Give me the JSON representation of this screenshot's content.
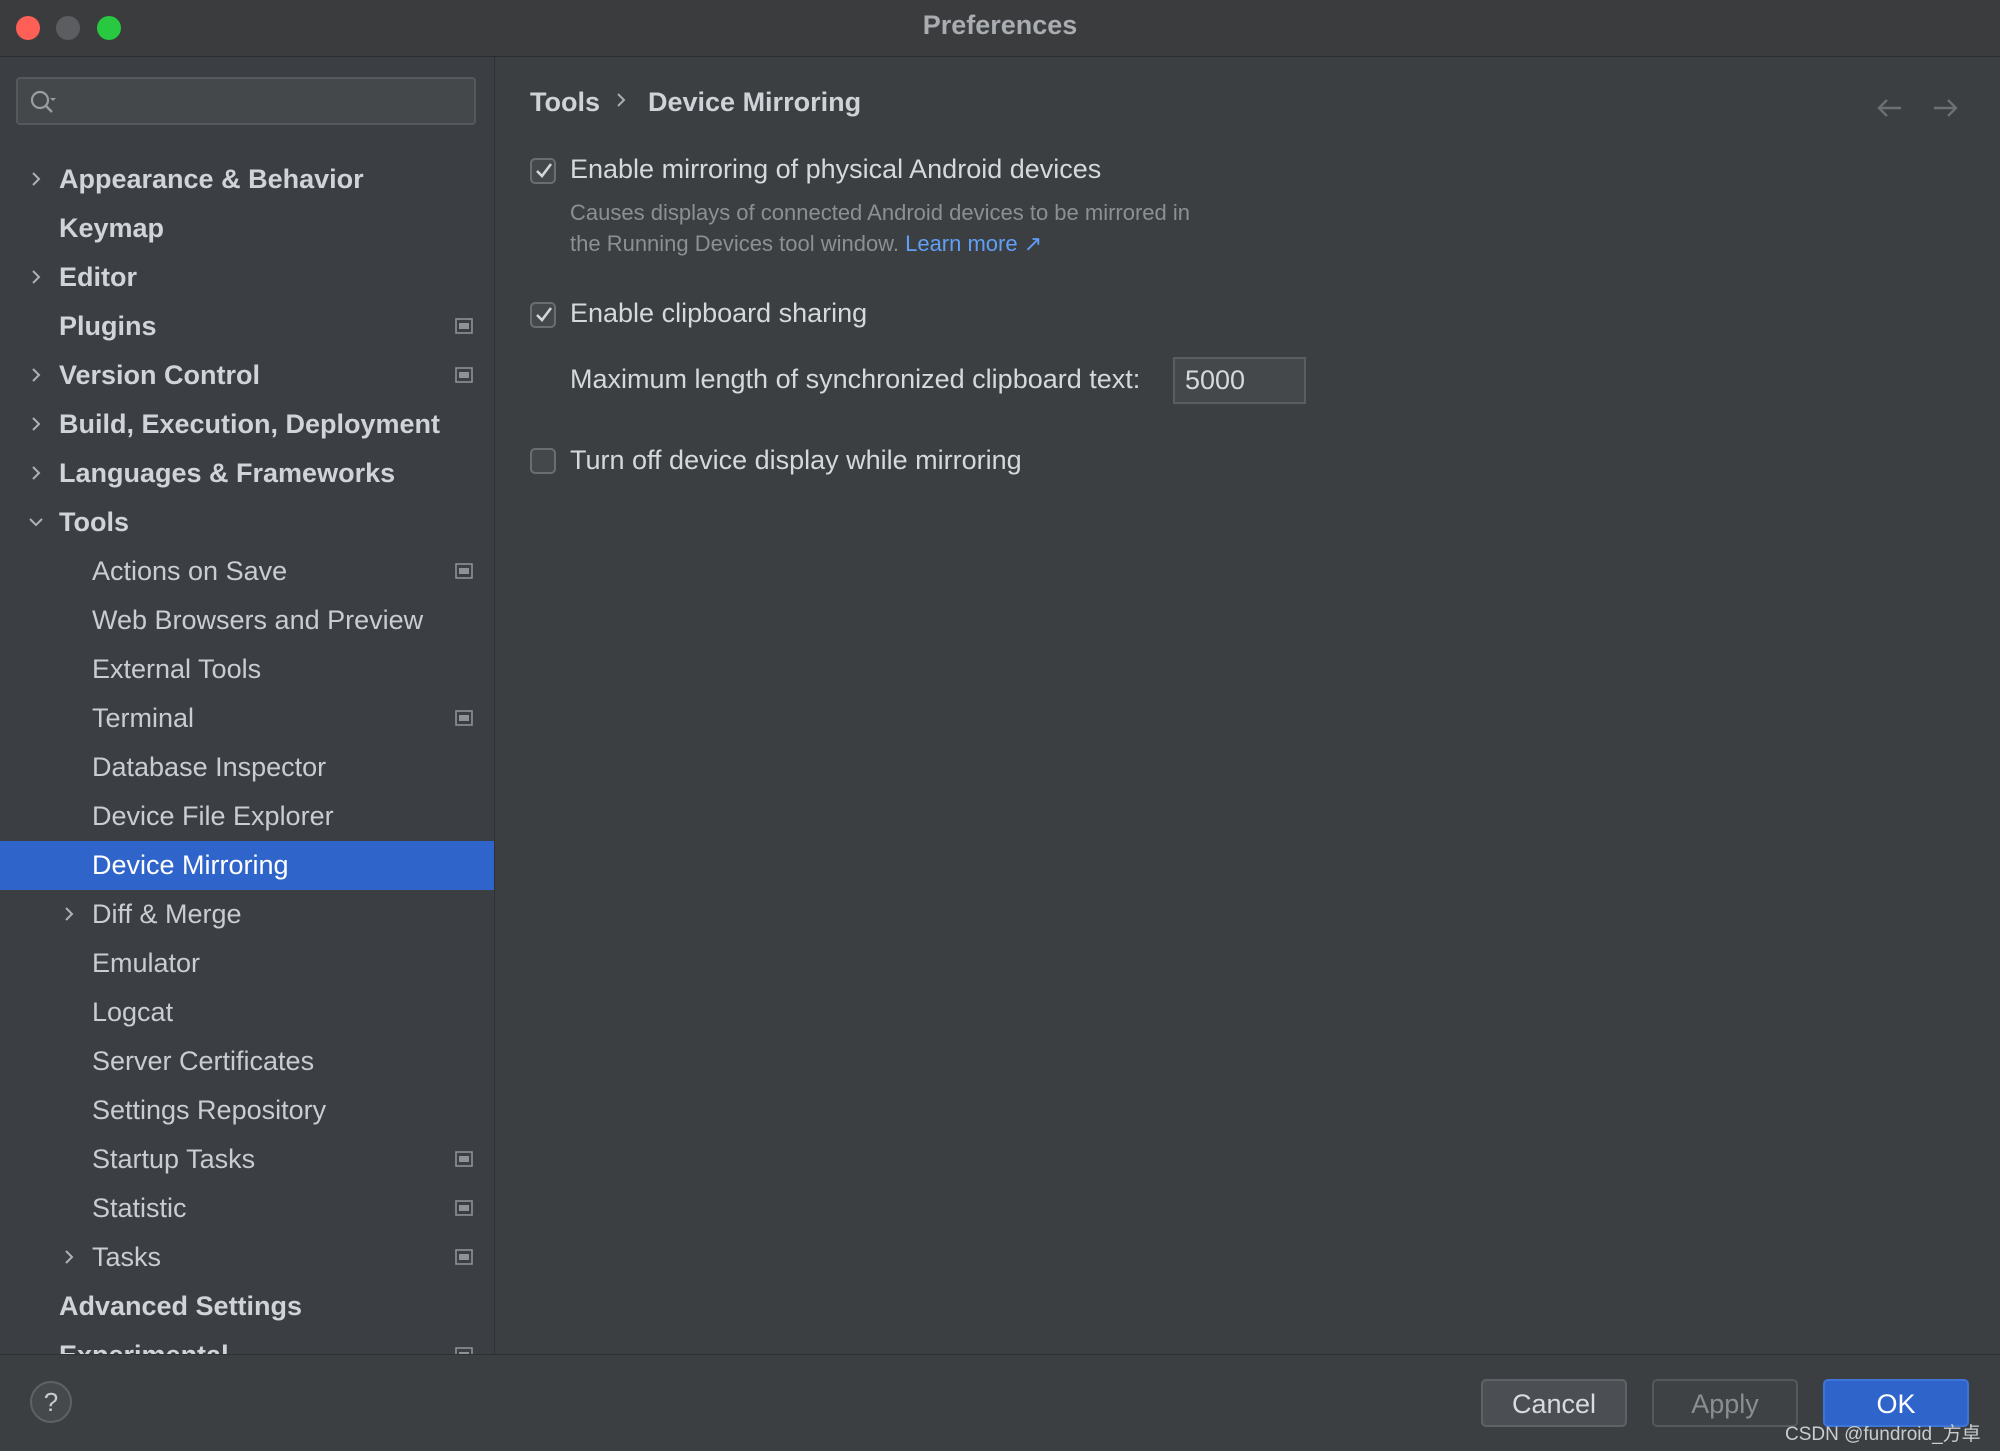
{
  "window": {
    "title": "Preferences"
  },
  "search": {
    "placeholder": ""
  },
  "sidebar": {
    "items": [
      {
        "label": "Appearance & Behavior",
        "style": "bold",
        "chevron": "right",
        "badge": false
      },
      {
        "label": "Keymap",
        "style": "bold",
        "chevron": "none",
        "badge": false
      },
      {
        "label": "Editor",
        "style": "bold",
        "chevron": "right",
        "badge": false
      },
      {
        "label": "Plugins",
        "style": "bold",
        "chevron": "none",
        "badge": true
      },
      {
        "label": "Version Control",
        "style": "bold",
        "chevron": "right",
        "badge": true
      },
      {
        "label": "Build, Execution, Deployment",
        "style": "bold",
        "chevron": "right",
        "badge": false
      },
      {
        "label": "Languages & Frameworks",
        "style": "bold",
        "chevron": "right",
        "badge": false
      },
      {
        "label": "Tools",
        "style": "bold",
        "chevron": "down",
        "badge": false
      },
      {
        "label": "Actions on Save",
        "style": "child",
        "chevron": "none",
        "badge": true
      },
      {
        "label": "Web Browsers and Preview",
        "style": "child",
        "chevron": "none",
        "badge": false
      },
      {
        "label": "External Tools",
        "style": "child",
        "chevron": "none",
        "badge": false
      },
      {
        "label": "Terminal",
        "style": "child",
        "chevron": "none",
        "badge": true
      },
      {
        "label": "Database Inspector",
        "style": "child",
        "chevron": "none",
        "badge": false
      },
      {
        "label": "Device File Explorer",
        "style": "child",
        "chevron": "none",
        "badge": false
      },
      {
        "label": "Device Mirroring",
        "style": "child",
        "chevron": "none",
        "badge": false,
        "selected": true
      },
      {
        "label": "Diff & Merge",
        "style": "child",
        "chevron": "right",
        "badge": false
      },
      {
        "label": "Emulator",
        "style": "child",
        "chevron": "none",
        "badge": false
      },
      {
        "label": "Logcat",
        "style": "child",
        "chevron": "none",
        "badge": false
      },
      {
        "label": "Server Certificates",
        "style": "child",
        "chevron": "none",
        "badge": false
      },
      {
        "label": "Settings Repository",
        "style": "child",
        "chevron": "none",
        "badge": false
      },
      {
        "label": "Startup Tasks",
        "style": "child",
        "chevron": "none",
        "badge": true
      },
      {
        "label": "Statistic",
        "style": "child",
        "chevron": "none",
        "badge": true
      },
      {
        "label": "Tasks",
        "style": "child",
        "chevron": "right",
        "badge": true
      },
      {
        "label": "Advanced Settings",
        "style": "bold",
        "chevron": "none",
        "badge": false
      },
      {
        "label": "Experimental",
        "style": "bold",
        "chevron": "none",
        "badge": true
      }
    ]
  },
  "breadcrumb": {
    "parent": "Tools",
    "current": "Device Mirroring"
  },
  "settings": {
    "mirroring": {
      "label": "Enable mirroring of physical Android devices",
      "checked": true,
      "description_line1": "Causes displays of connected Android devices to be mirrored in",
      "description_line2": "the Running Devices tool window.",
      "link": "Learn more ↗"
    },
    "clipboard": {
      "label": "Enable clipboard sharing",
      "checked": true
    },
    "max_length": {
      "label": "Maximum length of synchronized clipboard text:",
      "value": "5000"
    },
    "display_off": {
      "label": "Turn off device display while mirroring",
      "checked": false
    }
  },
  "footer": {
    "help": "?",
    "cancel": "Cancel",
    "apply": "Apply",
    "ok": "OK",
    "watermark": "CSDN @fundroid_方卓"
  },
  "colors": {
    "selection": "#2f65ca",
    "link": "#5f9ff5",
    "close": "#fe5f57",
    "maximize": "#28c840"
  }
}
